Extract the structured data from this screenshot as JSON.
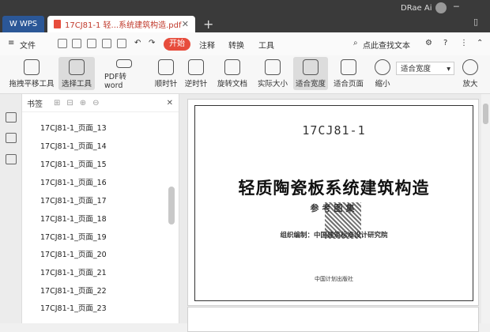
{
  "titlebar": {
    "wps_tab": "WPS",
    "doc_tab": "17CJ81-1 轻...系统建筑构造.pdf",
    "user_name": "DRae Ai"
  },
  "menubar": {
    "file": "文件",
    "start": "开始",
    "annotate": "注释",
    "convert": "转换",
    "tools": "工具",
    "search": "点此查找文本"
  },
  "toolbar": {
    "pan": "拖拽平移工具",
    "select": "选择工具",
    "pdf_to_word": "PDF转word",
    "rotate_cw": "顺时针",
    "rotate_ccw": "逆时针",
    "rotate_doc": "旋转文档",
    "actual_size": "实际大小",
    "fit_width": "适合宽度",
    "fit_page": "适合页面",
    "zoom_out": "缩小",
    "zoom_value": "适合宽度",
    "zoom_in": "放大"
  },
  "bookmarks": {
    "title": "书签",
    "items": [
      "17CJ81-1_页面_13",
      "17CJ81-1_页面_14",
      "17CJ81-1_页面_15",
      "17CJ81-1_页面_16",
      "17CJ81-1_页面_17",
      "17CJ81-1_页面_18",
      "17CJ81-1_页面_19",
      "17CJ81-1_页面_20",
      "17CJ81-1_页面_21",
      "17CJ81-1_页面_22",
      "17CJ81-1_页面_23"
    ]
  },
  "document": {
    "code": "17CJ81-1",
    "title": "轻质陶瓷板系统建筑构造",
    "subtitle": "参考图集",
    "org": "组织编制：中国建筑标准设计研究院",
    "publisher": "中国计划出版社"
  }
}
